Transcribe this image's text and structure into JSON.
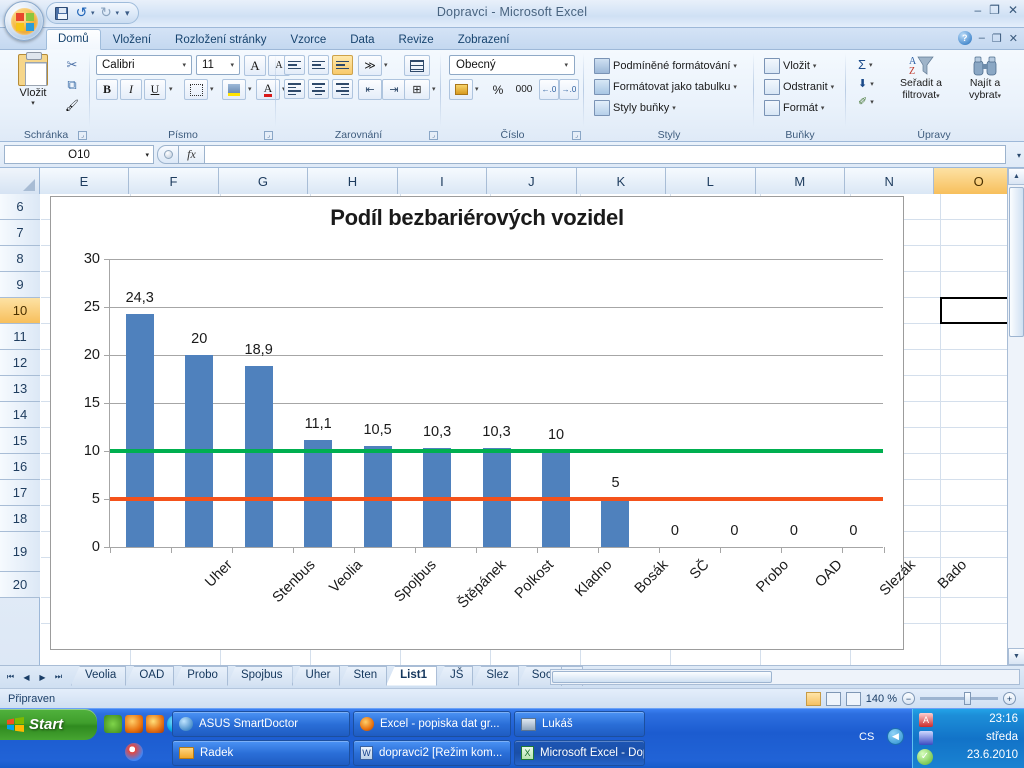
{
  "window": {
    "title": "Dopravci - Microsoft Excel",
    "minimize": "–",
    "maximize": "❐",
    "close": "✕"
  },
  "quick_access": {
    "save": "save-icon",
    "undo": "↺",
    "undo_caret": "▾",
    "redo": "↻",
    "redo_caret": "▾",
    "more": "▾"
  },
  "ribbon": {
    "tabs": [
      {
        "label": "Domů",
        "active": true
      },
      {
        "label": "Vložení",
        "active": false
      },
      {
        "label": "Rozložení stránky",
        "active": false
      },
      {
        "label": "Vzorce",
        "active": false
      },
      {
        "label": "Data",
        "active": false
      },
      {
        "label": "Revize",
        "active": false
      },
      {
        "label": "Zobrazení",
        "active": false
      }
    ],
    "help": "?",
    "win_min": "–",
    "win_restore": "❐",
    "win_close": "✕",
    "groups": {
      "clipboard": {
        "label": "Schránka",
        "paste": "Vložit",
        "paste_caret": "▾",
        "cut": "✂",
        "copy": "⧉",
        "format_painter": "🖌",
        "dialog": "⌟"
      },
      "font": {
        "label": "Písmo",
        "font_name": "Calibri",
        "font_size": "11",
        "grow": "A",
        "shrink": "A",
        "bold": "B",
        "italic": "I",
        "underline": "U",
        "borders": "▦",
        "fill": "▲",
        "color": "A",
        "dialog": "⌟"
      },
      "alignment": {
        "label": "Zarovnání",
        "orientation": "≫",
        "wrap": "⤶",
        "merge": "⊞",
        "dialog": "⌟"
      },
      "number": {
        "label": "Číslo",
        "format": "Obecný",
        "currency": "💰",
        "percent": "%",
        "thousands": "000",
        "inc_dec": ".0→",
        "dec_dec": "→.0",
        "dialog": "⌟"
      },
      "styles": {
        "label": "Styly",
        "items": [
          "Podmíněné formátování",
          "Formátovat jako tabulku",
          "Styly buňky"
        ],
        "caret": "▾"
      },
      "cells": {
        "label": "Buňky",
        "items": [
          "Vložit",
          "Odstranit",
          "Formát"
        ],
        "caret": "▾"
      },
      "editing": {
        "label": "Úpravy",
        "sum": "Σ",
        "fill": "⬇",
        "clear": "✐",
        "sort_filter_line1": "Seřadit a",
        "sort_filter_line2": "filtrovat",
        "find_select_line1": "Najít a",
        "find_select_line2": "vybrat",
        "caret": "▾"
      }
    }
  },
  "formula_bar": {
    "name_box": "O10",
    "name_caret": "▾",
    "fx": "fx",
    "formula_value": "",
    "expand_caret": "▾"
  },
  "grid": {
    "columns": [
      "E",
      "F",
      "G",
      "H",
      "I",
      "J",
      "K",
      "L",
      "M",
      "N",
      "O"
    ],
    "selected_column": "O",
    "rows": [
      "6",
      "7",
      "8",
      "9",
      "10",
      "11",
      "12",
      "13",
      "14",
      "15",
      "",
      "16",
      "17",
      "18",
      "",
      "19",
      "20"
    ],
    "selected_row": "10",
    "active_cell": "O10"
  },
  "chart_data": {
    "type": "bar",
    "title": "Podíl bezbariérových vozidel",
    "xlabel": "",
    "ylabel": "",
    "ylim": [
      0,
      30
    ],
    "yticks": [
      0,
      5,
      10,
      15,
      20,
      25,
      30
    ],
    "grid": true,
    "legend": "none",
    "categories": [
      "Uher",
      "Stenbus",
      "Veolia",
      "Spojbus",
      "Štěpánek",
      "Polkost",
      "Kladno",
      "Bosák",
      "SČ",
      "Probo",
      "OAD",
      "Slezák",
      "Bado"
    ],
    "values": [
      24.3,
      20,
      18.9,
      11.1,
      10.5,
      10.3,
      10.3,
      10,
      5,
      0,
      0,
      0,
      0
    ],
    "data_labels": [
      "24,3",
      "20",
      "18,9",
      "11,1",
      "10,5",
      "10,3",
      "10,3",
      "10",
      "5",
      "0",
      "0",
      "0",
      "0"
    ],
    "bar_color": "#4f81bd",
    "reference_lines": [
      {
        "value": 10,
        "color": "#00af50"
      },
      {
        "value": 5,
        "color": "#f4521b"
      }
    ]
  },
  "sheet_tabs": {
    "nav": [
      "⏮",
      "◀",
      "▶",
      "⏭"
    ],
    "tabs": [
      {
        "label": "Veolia",
        "active": false
      },
      {
        "label": "OAD",
        "active": false
      },
      {
        "label": "Probo",
        "active": false
      },
      {
        "label": "Spojbus",
        "active": false
      },
      {
        "label": "Uher",
        "active": false
      },
      {
        "label": "Sten",
        "active": false
      },
      {
        "label": "List1",
        "active": true
      },
      {
        "label": "JŠ",
        "active": false
      },
      {
        "label": "Slez",
        "active": false
      },
      {
        "label": "Soc",
        "active": false
      }
    ],
    "new_sheet": "✷"
  },
  "status_bar": {
    "state": "Připraven",
    "zoom": "140 %",
    "zoom_out": "−",
    "zoom_in": "+",
    "views": [
      "normal-view",
      "page-layout-view",
      "page-break-view"
    ]
  },
  "taskbar": {
    "start": "Start",
    "quick_launch": [
      "desktop-icon",
      "firefox-icon",
      "media-player-icon",
      "skype-icon",
      "flash-icon",
      "email-icon",
      "chrome-icon"
    ],
    "buttons": [
      {
        "label": "ASUS SmartDoctor",
        "icon": "asus-icon",
        "active": false,
        "row": 0,
        "col": 0
      },
      {
        "label": "Radek",
        "icon": "folder-icon",
        "active": false,
        "row": 1,
        "col": 0
      },
      {
        "label": "Excel - popiska dat gr...",
        "icon": "firefox-icon",
        "active": false,
        "row": 0,
        "col": 1
      },
      {
        "label": "dopravci2 [Režim kom...",
        "icon": "word-icon",
        "active": false,
        "row": 1,
        "col": 1
      },
      {
        "label": "Lukáš",
        "icon": "messenger-icon",
        "active": false,
        "row": 0,
        "col": 2
      },
      {
        "label": "Microsoft Excel - Dop...",
        "icon": "excel-icon",
        "active": true,
        "row": 1,
        "col": 2
      }
    ],
    "tray": {
      "language": "CS",
      "arrow": "◀",
      "time": "23:16",
      "day": "středa",
      "date": "23.6.2010"
    }
  }
}
